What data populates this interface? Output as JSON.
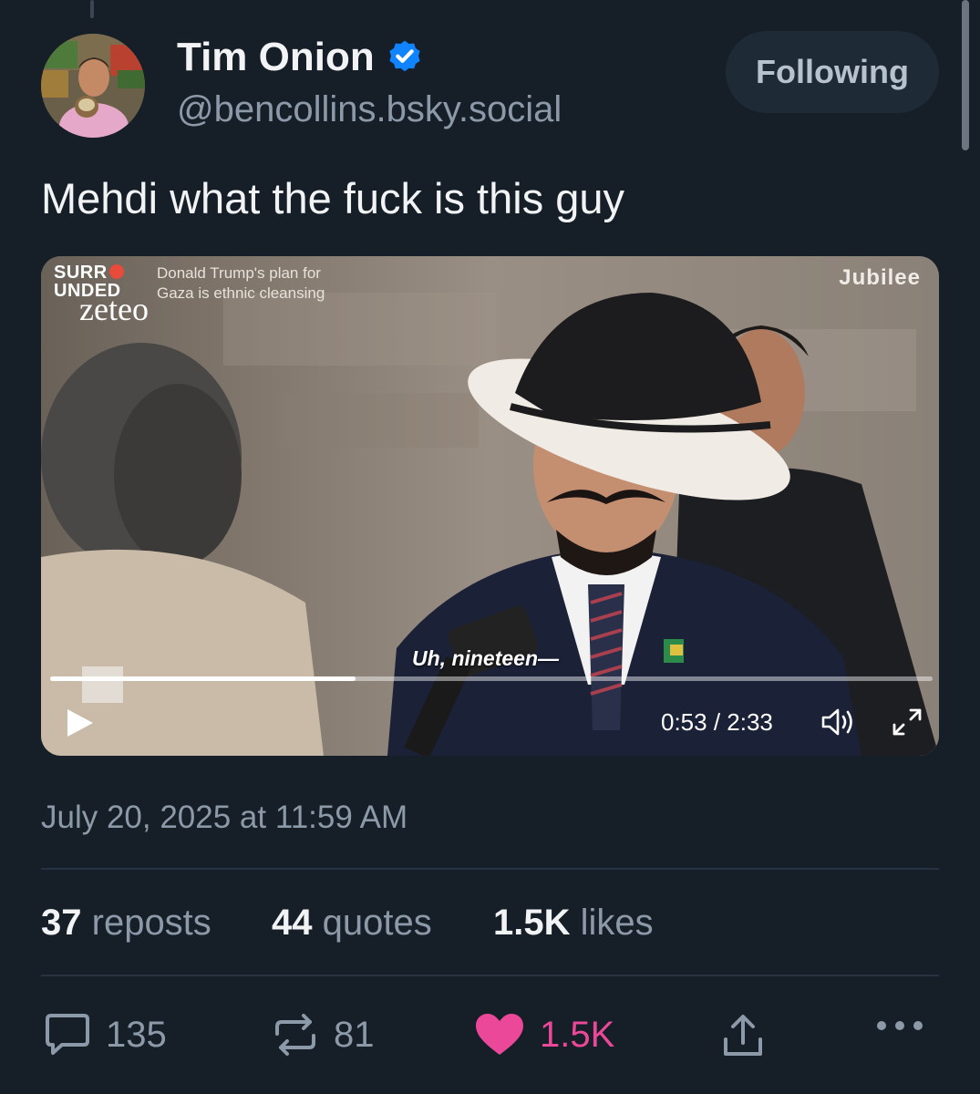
{
  "post": {
    "author": {
      "display_name": "Tim Onion",
      "handle": "@bencollins.bsky.social",
      "verified": true
    },
    "follow_label": "Following",
    "text": "Mehdi what the fuck is this guy",
    "video": {
      "overlay": {
        "logo_top": "SURR",
        "logo_bottom": "UNDED",
        "subtitle_line1": "Donald Trump's plan for",
        "subtitle_line2": "Gaza is ethnic cleansing",
        "brand": "zeteo",
        "watermark": "Jubilee"
      },
      "caption": "Uh, nineteen—",
      "progress": 0.346,
      "time_readout": "0:53 / 2:33"
    },
    "timestamp": "July 20, 2025 at 11:59 AM",
    "stats": {
      "reposts_count": "37",
      "reposts_label": "reposts",
      "quotes_count": "44",
      "quotes_label": "quotes",
      "likes_count": "1.5K",
      "likes_label": "likes"
    },
    "actions": {
      "replies": "135",
      "reposts": "81",
      "likes": "1.5K"
    },
    "colors": {
      "background": "#161e27",
      "muted_text": "#8c99a8",
      "verified_blue": "#1083fe",
      "like_pink": "#ec4899",
      "button_bg": "#1f2a37"
    },
    "icons": [
      "verified-badge-icon",
      "play-icon",
      "volume-icon",
      "fullscreen-icon",
      "reply-icon",
      "repost-icon",
      "heart-icon",
      "share-icon",
      "more-icon"
    ]
  }
}
